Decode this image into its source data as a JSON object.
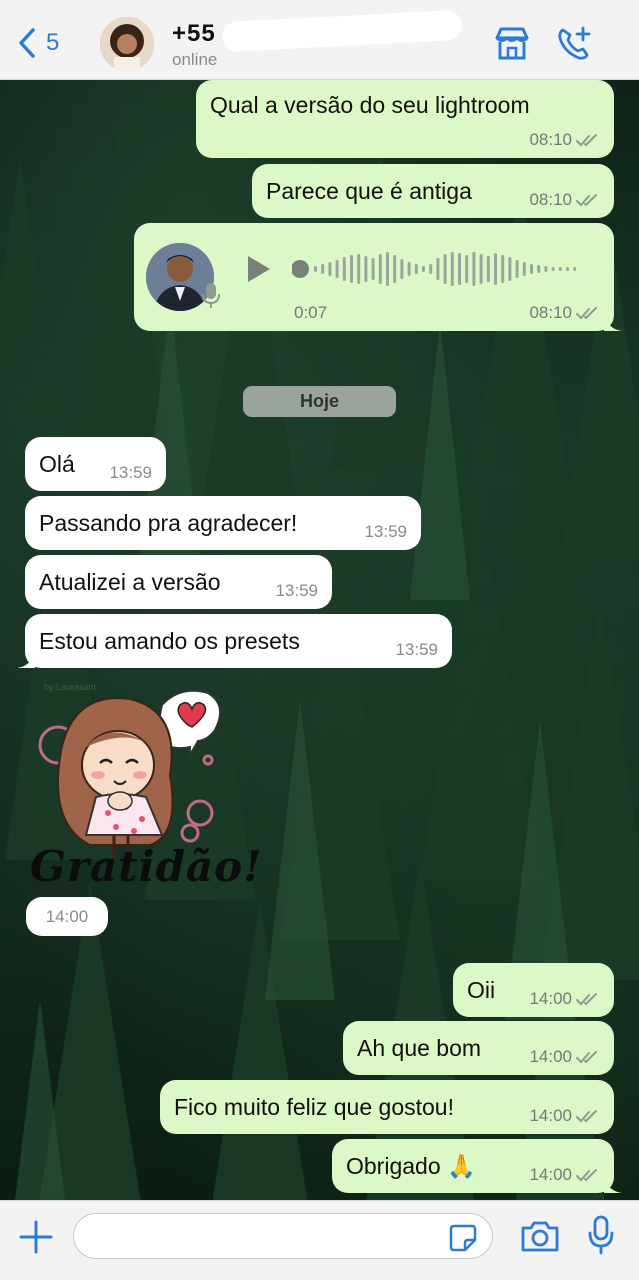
{
  "header": {
    "back_count": "5",
    "contact_name": "+55",
    "status": "online"
  },
  "messages_before": [
    {
      "text": "Qual a versão do seu lightroom",
      "time": "08:10"
    },
    {
      "text": "Parece que é antiga",
      "time": "08:10"
    }
  ],
  "voice_note": {
    "duration": "0:07",
    "time": "08:10"
  },
  "date_divider": "Hoje",
  "incoming": [
    {
      "text": "Olá",
      "time": "13:59"
    },
    {
      "text": "Passando pra agradecer!",
      "time": "13:59"
    },
    {
      "text": "Atualizei a versão",
      "time": "13:59"
    },
    {
      "text": "Estou amando os presets",
      "time": "13:59"
    }
  ],
  "sticker": {
    "caption": "Gratidão!",
    "credit": "by Laurasant",
    "time": "14:00"
  },
  "outgoing": [
    {
      "text": "Oii",
      "time": "14:00"
    },
    {
      "text": "Ah que bom",
      "time": "14:00"
    },
    {
      "text": "Fico muito feliz que gostou!",
      "time": "14:00"
    },
    {
      "text": "Obrigado 🙏",
      "time": "14:00"
    }
  ],
  "composer": {
    "placeholder": ""
  },
  "colors": {
    "outgoing_bubble": "#dcf8c6",
    "incoming_bubble": "#ffffff",
    "accent": "#2c7bd6"
  }
}
